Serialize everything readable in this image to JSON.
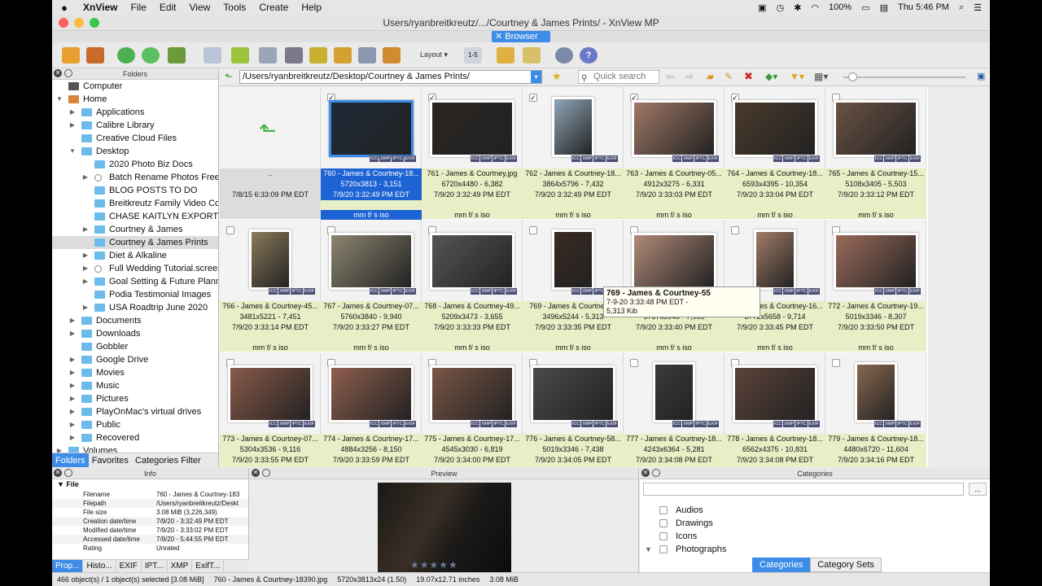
{
  "menubar": {
    "app": "XnView",
    "items": [
      "File",
      "Edit",
      "View",
      "Tools",
      "Create",
      "Help"
    ],
    "battery": "100%",
    "clock": "Thu 5:46 PM"
  },
  "window": {
    "title": "Users/ryanbreitkreutz/.../Courtney & James Prints/ - XnView MP"
  },
  "tab": {
    "label": "Browser"
  },
  "toolbar": {
    "layout_label": "Layout",
    "range_label": "1-5"
  },
  "left": {
    "title": "Folders",
    "tree": [
      {
        "label": "Computer",
        "depth": 0,
        "expander": "",
        "icon": "sys"
      },
      {
        "label": "Home",
        "depth": 0,
        "expander": "▼",
        "icon": "home"
      },
      {
        "label": "Applications",
        "depth": 1,
        "expander": "▶",
        "icon": "folder"
      },
      {
        "label": "Calibre Library",
        "depth": 1,
        "expander": "▶",
        "icon": "folder"
      },
      {
        "label": "Creative Cloud Files",
        "depth": 1,
        "expander": "",
        "icon": "folder"
      },
      {
        "label": "Desktop",
        "depth": 1,
        "expander": "▼",
        "icon": "folder"
      },
      {
        "label": "2020 Photo Biz Docs",
        "depth": 2,
        "expander": "",
        "icon": "folder"
      },
      {
        "label": "Batch Rename Photos Free",
        "depth": 2,
        "expander": "▶",
        "icon": "gear"
      },
      {
        "label": "BLOG POSTS TO DO",
        "depth": 2,
        "expander": "",
        "icon": "folder"
      },
      {
        "label": "Breitkreutz Family Video Co",
        "depth": 2,
        "expander": "",
        "icon": "folder"
      },
      {
        "label": "CHASE KAITLYN EXPORTS",
        "depth": 2,
        "expander": "",
        "icon": "folder"
      },
      {
        "label": "Courtney & James",
        "depth": 2,
        "expander": "▶",
        "icon": "folder"
      },
      {
        "label": "Courtney & James Prints",
        "depth": 2,
        "expander": "",
        "icon": "folder",
        "selected": true
      },
      {
        "label": "Diet & Alkaline",
        "depth": 2,
        "expander": "▶",
        "icon": "folder"
      },
      {
        "label": "Full Wedding Tutorial.screer",
        "depth": 2,
        "expander": "▶",
        "icon": "gear"
      },
      {
        "label": "Goal Setting & Future Plann",
        "depth": 2,
        "expander": "▶",
        "icon": "folder"
      },
      {
        "label": "Podia Testimonial Images",
        "depth": 2,
        "expander": "",
        "icon": "folder"
      },
      {
        "label": "USA Roadtrip June 2020",
        "depth": 2,
        "expander": "▶",
        "icon": "folder"
      },
      {
        "label": "Documents",
        "depth": 1,
        "expander": "▶",
        "icon": "folder"
      },
      {
        "label": "Downloads",
        "depth": 1,
        "expander": "▶",
        "icon": "folder"
      },
      {
        "label": "Gobbler",
        "depth": 1,
        "expander": "",
        "icon": "folder"
      },
      {
        "label": "Google Drive",
        "depth": 1,
        "expander": "▶",
        "icon": "folder"
      },
      {
        "label": "Movies",
        "depth": 1,
        "expander": "▶",
        "icon": "folder"
      },
      {
        "label": "Music",
        "depth": 1,
        "expander": "▶",
        "icon": "folder"
      },
      {
        "label": "Pictures",
        "depth": 1,
        "expander": "▶",
        "icon": "folder"
      },
      {
        "label": "PlayOnMac's virtual drives",
        "depth": 1,
        "expander": "▶",
        "icon": "folder"
      },
      {
        "label": "Public",
        "depth": 1,
        "expander": "▶",
        "icon": "folder"
      },
      {
        "label": "Recovered",
        "depth": 1,
        "expander": "▶",
        "icon": "folder"
      },
      {
        "label": "Volumes",
        "depth": 0,
        "expander": "▶",
        "icon": "folder"
      }
    ],
    "tabs": [
      "Folders",
      "Favorites",
      "Categories Filter"
    ]
  },
  "pathbar": {
    "path": "/Users/ryanbreitkreutz/Desktop/Courtney & James Prints/",
    "search_placeholder": "Quick search"
  },
  "grid": {
    "meta_badges": [
      "ICC",
      "XMP",
      "IPTC",
      "EXIF"
    ],
    "parent": {
      "name": "..",
      "date": "7/8/15 6:33:09 PM EDT"
    },
    "items": [
      {
        "name": "760 - James & Courtney-18...",
        "dims": "5720x3813 - 3,151",
        "date": "7/9/20 3:32:49 PM EDT",
        "exif": "mm f/ s iso",
        "checked": true,
        "selected": true,
        "color": "#1e2a38",
        "shape": "landscape"
      },
      {
        "name": "761 - James & Courtney.jpg",
        "dims": "6720x4480 - 6,382",
        "date": "7/9/20 3:32:49 PM EDT",
        "exif": "mm f/ s iso",
        "checked": true,
        "color": "#2a2522",
        "shape": "landscape"
      },
      {
        "name": "762 - James & Courtney-18...",
        "dims": "3864x5796 - 7,432",
        "date": "7/9/20 3:32:49 PM EDT",
        "exif": "mm f/ s iso",
        "checked": true,
        "color": "#8fa6b8",
        "shape": "portrait"
      },
      {
        "name": "763 - James & Courtney-05...",
        "dims": "4912x3275 - 6,331",
        "date": "7/9/20 3:33:03 PM EDT",
        "exif": "mm f/ s iso",
        "checked": true,
        "color": "#a07866",
        "shape": "landscape"
      },
      {
        "name": "764 - James & Courtney-18...",
        "dims": "6593x4395 - 10,354",
        "date": "7/9/20 3:33:04 PM EDT",
        "exif": "mm f/ s iso",
        "checked": true,
        "color": "#4a3a2c",
        "shape": "landscape"
      },
      {
        "name": "765 - James & Courtney-15...",
        "dims": "5108x3405 - 5,503",
        "date": "7/9/20 3:33:12 PM EDT",
        "exif": "mm f/ s iso",
        "checked": false,
        "color": "#6a5244",
        "shape": "landscape"
      },
      {
        "name": "766 - James & Courtney-45...",
        "dims": "3481x5221 - 7,451",
        "date": "7/9/20 3:33:14 PM EDT",
        "exif": "mm f/ s iso",
        "checked": false,
        "color": "#8a7a5a",
        "shape": "portrait"
      },
      {
        "name": "767 - James & Courtney-07...",
        "dims": "5760x3840 - 9,940",
        "date": "7/9/20 3:33:27 PM EDT",
        "exif": "mm f/ s iso",
        "checked": false,
        "color": "#8c8570",
        "shape": "landscape"
      },
      {
        "name": "768 - James & Courtney-49...",
        "dims": "5209x3473 - 3,655",
        "date": "7/9/20 3:33:33 PM EDT",
        "exif": "mm f/ s iso",
        "checked": false,
        "color": "#555",
        "shape": "landscape"
      },
      {
        "name": "769 - James & Courtney-...",
        "dims": "3496x5244 - 5,313",
        "date": "7/9/20 3:33:35 PM EDT",
        "exif": "mm f/ s iso",
        "checked": false,
        "color": "#3a2a22",
        "shape": "portrait"
      },
      {
        "name": "770 - James & Courtney-92...",
        "dims": "5787x3945 - 7,965",
        "date": "7/9/20 3:33:40 PM EDT",
        "exif": "mm f/ s iso",
        "checked": false,
        "color": "#b08a78",
        "shape": "landscape"
      },
      {
        "name": "771 - James & Courtney-16...",
        "dims": "3772x5658 - 9,714",
        "date": "7/9/20 3:33:45 PM EDT",
        "exif": "mm f/ s iso",
        "checked": false,
        "color": "#a27c68",
        "shape": "portrait"
      },
      {
        "name": "772 - James & Courtney-19...",
        "dims": "5019x3346 - 8,307",
        "date": "7/9/20 3:33:50 PM EDT",
        "exif": "mm f/ s iso",
        "checked": false,
        "color": "#9a6a5a",
        "shape": "landscape"
      },
      {
        "name": "773 - James & Courtney-07...",
        "dims": "5304x3536 - 9,116",
        "date": "7/9/20 3:33:55 PM EDT",
        "exif": "",
        "checked": false,
        "color": "#8a5a4a",
        "shape": "landscape"
      },
      {
        "name": "774 - James & Courtney-17...",
        "dims": "4884x3256 - 8,150",
        "date": "7/9/20 3:33:59 PM EDT",
        "exif": "",
        "checked": false,
        "color": "#8e5e4e",
        "shape": "landscape"
      },
      {
        "name": "775 - James & Courtney-17...",
        "dims": "4545x3030 - 6,819",
        "date": "7/9/20 3:34:00 PM EDT",
        "exif": "",
        "checked": false,
        "color": "#7a5646",
        "shape": "landscape"
      },
      {
        "name": "776 - James & Courtney-58...",
        "dims": "5019x3346 - 7,438",
        "date": "7/9/20 3:34:05 PM EDT",
        "exif": "",
        "checked": false,
        "color": "#4a4a4a",
        "shape": "landscape"
      },
      {
        "name": "777 - James & Courtney-18...",
        "dims": "4243x6364 - 5,281",
        "date": "7/9/20 3:34:08 PM EDT",
        "exif": "",
        "checked": false,
        "color": "#3a3a3a",
        "shape": "portrait"
      },
      {
        "name": "778 - James & Courtney-18...",
        "dims": "6562x4375 - 10,831",
        "date": "7/9/20 3:34:08 PM EDT",
        "exif": "",
        "checked": false,
        "color": "#5a4238",
        "shape": "landscape"
      },
      {
        "name": "779 - James & Courtney-18...",
        "dims": "4480x6720 - 11,604",
        "date": "7/9/20 3:34:16 PM EDT",
        "exif": "",
        "checked": false,
        "color": "#8a6850",
        "shape": "portrait"
      }
    ]
  },
  "tooltip": {
    "title": "769 - James & Courtney-55",
    "line2": "7-9-20 3:33:48 PM EDT -",
    "line3": "5,313 Kib"
  },
  "info": {
    "title": "Info",
    "section": "File",
    "rows": [
      {
        "k": "Filename",
        "v": "760 - James & Courtney-183"
      },
      {
        "k": "Filepath",
        "v": "/Users/ryanbreitkreutz/Deskt"
      },
      {
        "k": "File size",
        "v": "3.08 MiB (3,226,349)"
      },
      {
        "k": "Creation date/time",
        "v": "7/9/20 - 3:32:49 PM EDT"
      },
      {
        "k": "Modified date/time",
        "v": "7/9/20 - 3:33:02 PM EDT"
      },
      {
        "k": "Accessed date/time",
        "v": "7/9/20 - 5:44:55 PM EDT"
      },
      {
        "k": "Rating",
        "v": "Unrated"
      }
    ],
    "tabs": [
      "Prop...",
      "Histo...",
      "EXIF",
      "IPT...",
      "XMP",
      "ExifT..."
    ]
  },
  "preview": {
    "title": "Preview"
  },
  "categories": {
    "title": "Categories",
    "button": "...",
    "items": [
      {
        "label": "Audios",
        "expander": ""
      },
      {
        "label": "Drawings",
        "expander": ""
      },
      {
        "label": "Icons",
        "expander": ""
      },
      {
        "label": "Photographs",
        "expander": "▼"
      }
    ],
    "tabs": [
      "Categories",
      "Category Sets"
    ]
  },
  "status": {
    "objects": "466 object(s) / 1 object(s) selected [3.08 MiB]",
    "file": "760 - James & Courtney-18390.jpg",
    "dims": "5720x3813x24 (1.50)",
    "inches": "19.07x12.71 inches",
    "size": "3.08 MiB"
  }
}
